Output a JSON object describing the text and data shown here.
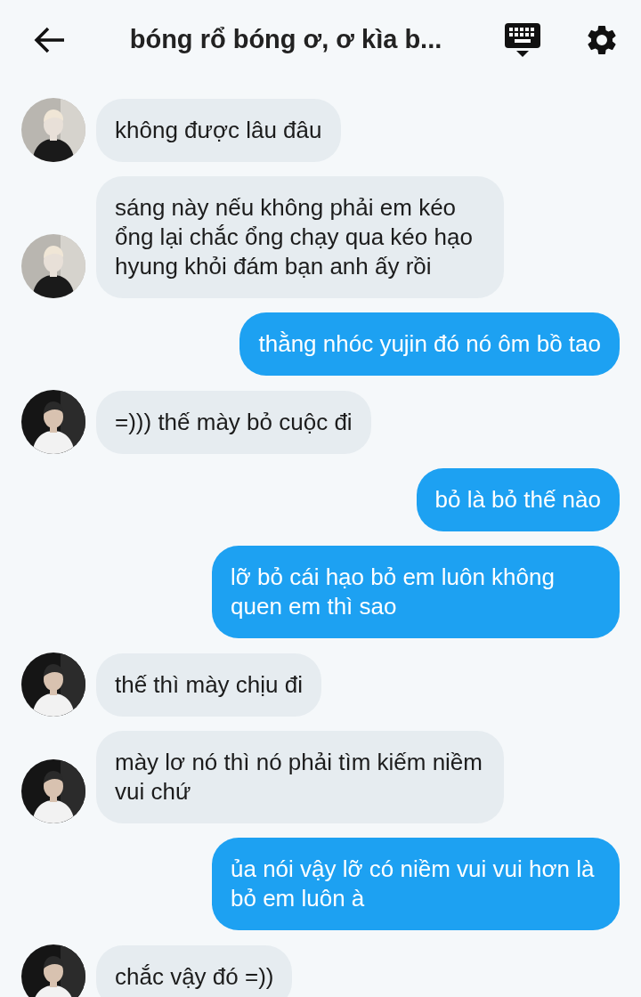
{
  "header": {
    "title": "bóng rổ bóng ơ, ơ kìa b..."
  },
  "messages": [
    {
      "kind": "received",
      "text": "không được lâu đâu"
    },
    {
      "kind": "received",
      "text": "sáng này nếu không phải em kéo ổng lại chắc ổng chạy qua kéo hạo hyung khỏi đám bạn anh ấy rồi"
    },
    {
      "kind": "sent",
      "text": "thằng nhóc yujin đó nó ôm bồ tao"
    },
    {
      "kind": "received",
      "text": "=))) thế mày bỏ cuộc đi"
    },
    {
      "kind": "sent",
      "text": "bỏ là bỏ thế nào"
    },
    {
      "kind": "sent",
      "text": "lỡ bỏ cái hạo bỏ em luôn không quen em thì sao"
    },
    {
      "kind": "received",
      "text": "thế thì mày chịu đi"
    },
    {
      "kind": "received",
      "text": "mày lơ nó thì nó phải tìm kiếm niềm vui chứ"
    },
    {
      "kind": "sent",
      "text": "ủa nói vậy lỡ có niềm vui vui hơn là bỏ em luôn à"
    },
    {
      "kind": "received",
      "text": "chắc vậy đó =))"
    }
  ]
}
